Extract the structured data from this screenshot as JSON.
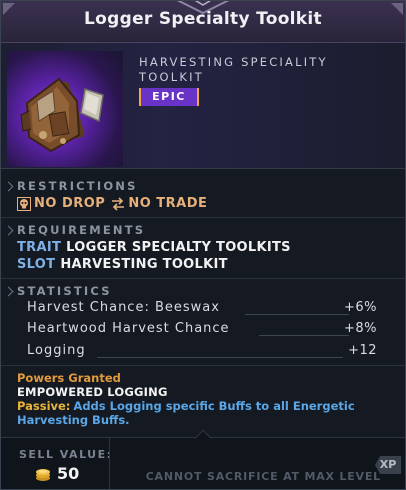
{
  "tooltip": {
    "title": "Logger Specialty Toolkit",
    "subtype": "HARVESTING SPECIALITY TOOLKIT",
    "rarity": "EPIC",
    "colors": {
      "rarity": "#6a33c8",
      "accent": "#e29b3c",
      "key": "#7fb0e6",
      "passive_text": "#5aa6e6"
    }
  },
  "restrictions": {
    "label": "RESTRICTIONS",
    "items": [
      {
        "icon": "skull-icon",
        "text": "NO DROP"
      },
      {
        "icon": "swap-arrows-icon",
        "text": "NO TRADE"
      }
    ]
  },
  "requirements": {
    "label": "REQUIREMENTS",
    "items": [
      {
        "key": "TRAIT",
        "value": "LOGGER SPECIALTY TOOLKITS"
      },
      {
        "key": "SLOT",
        "value": "HARVESTING TOOLKIT"
      }
    ]
  },
  "statistics": {
    "label": "STATISTICS",
    "items": [
      {
        "name": "Harvest Chance: Beeswax",
        "value": "+6%"
      },
      {
        "name": "Heartwood Harvest Chance",
        "value": "+8%"
      },
      {
        "name": "Logging",
        "value": "+12"
      }
    ]
  },
  "powers": {
    "label": "Powers Granted",
    "name": "EMPOWERED LOGGING",
    "passive_key": "Passive:",
    "passive_text": "Adds Logging specific Buffs to all Energetic Harvesting Buffs."
  },
  "footer": {
    "sell_label": "SELL VALUE:",
    "sell_value": "50",
    "sacrifice_text": "CANNOT SACRIFICE AT MAX LEVEL",
    "xp_badge": "XP"
  }
}
